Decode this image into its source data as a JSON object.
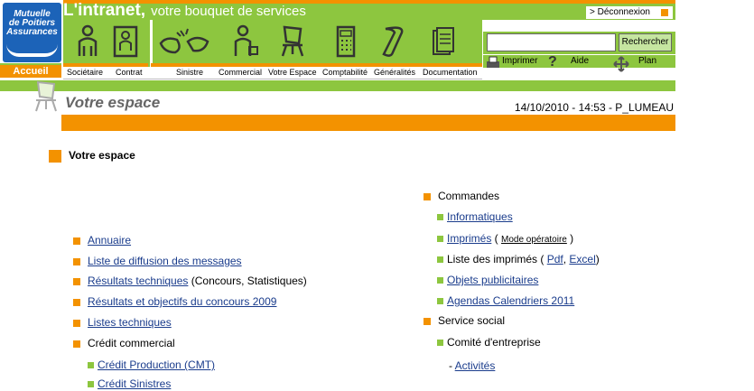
{
  "logo": {
    "line1": "Mutuelle",
    "line2": "de Poitiers",
    "line3": "Assurances"
  },
  "brand": {
    "name": "L'intranet,",
    "tagline": "votre bouquet de services"
  },
  "header": {
    "deconnexion": "> Déconnexion",
    "accueil": "Accueil"
  },
  "nav": [
    {
      "label": "Sociétaire",
      "icon": "person-icon"
    },
    {
      "label": "Contrat",
      "icon": "contract-icon"
    },
    {
      "label": "Sinistre",
      "icon": "accident-icon"
    },
    {
      "label": "Commercial",
      "icon": "salesman-icon"
    },
    {
      "label": "Votre Espace",
      "icon": "chair-icon"
    },
    {
      "label": "Comptabilité",
      "icon": "calculator-icon"
    },
    {
      "label": "Généralités",
      "icon": "scroll-icon"
    },
    {
      "label": "Documentation",
      "icon": "documents-icon"
    }
  ],
  "search": {
    "value": "",
    "button": "Rechercher"
  },
  "tools": {
    "print": "Imprimer",
    "help": "Aide",
    "plan": "Plan"
  },
  "page": {
    "title": "Votre espace",
    "datestamp": "14/10/2010 - 14:53 - P_LUMEAU"
  },
  "section": {
    "title": "Votre espace"
  },
  "left_list": {
    "annuaire": "Annuaire",
    "diffusion": "Liste de diffusion des messages",
    "resultats_link": "Résultats techniques",
    "resultats_suffix": " (Concours, Statistiques)",
    "concours": "Résultats et objectifs du concours 2009",
    "listes": "Listes techniques",
    "credit": "Crédit commercial",
    "credit_prod": "Crédit Production (CMT)",
    "credit_sin": "Crédit Sinistres"
  },
  "right_list": {
    "commandes": "Commandes",
    "informatiques": "Informatiques",
    "imprimes": "Imprimés",
    "imprimes_open": " ( ",
    "mode_operatoire": "Mode opératoire",
    "imprimes_close": " )",
    "liste_imprimes": "Liste des imprimés (",
    "pdf": "Pdf",
    "comma": ", ",
    "excel": "Excel",
    "close_paren": ")",
    "objets": "Objets publicitaires",
    "agendas": "Agendas Calendriers 2011",
    "service_social": "Service social",
    "comite": "Comité d'entreprise",
    "dash": "- ",
    "activites": "Activités"
  },
  "colors": {
    "green": "#8dc63f",
    "orange": "#f39200",
    "logo_blue": "#1c63b8"
  }
}
